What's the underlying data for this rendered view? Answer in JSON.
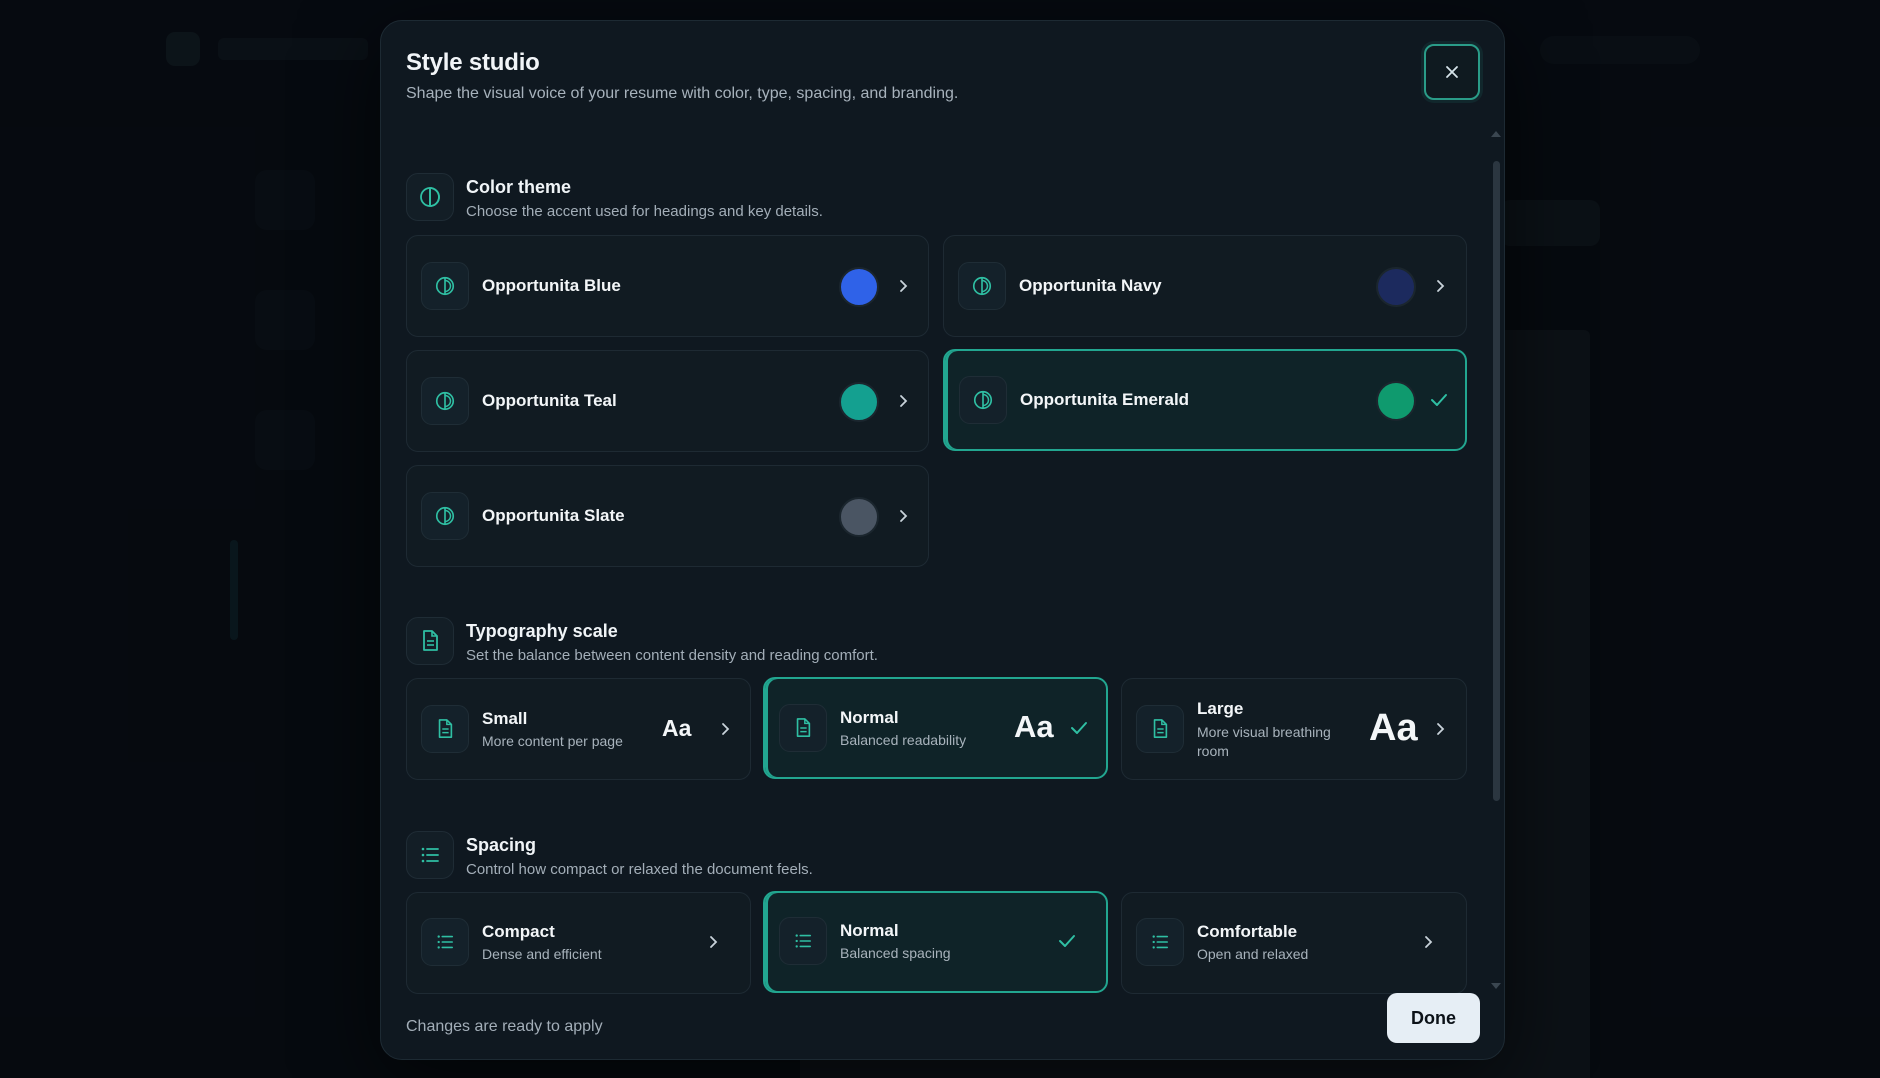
{
  "modal": {
    "title": "Style studio",
    "subtitle": "Shape the visual voice of your resume with color, type, spacing, and branding."
  },
  "color_theme": {
    "title": "Color theme",
    "subtitle": "Choose the accent used for headings and key details.",
    "options": [
      {
        "label": "Opportunita Blue",
        "color": "#2f62e8",
        "selected": false
      },
      {
        "label": "Opportunita Navy",
        "color": "#1c2a5e",
        "selected": false
      },
      {
        "label": "Opportunita Teal",
        "color": "#14a090",
        "selected": false
      },
      {
        "label": "Opportunita Emerald",
        "color": "#0f9a6e",
        "selected": true
      },
      {
        "label": "Opportunita Slate",
        "color": "#4a5563",
        "selected": false
      }
    ]
  },
  "typography": {
    "title": "Typography scale",
    "subtitle": "Set the balance between content density and reading comfort.",
    "sample": "Aa",
    "options": [
      {
        "label": "Small",
        "desc": "More content per page",
        "selected": false
      },
      {
        "label": "Normal",
        "desc": "Balanced readability",
        "selected": true
      },
      {
        "label": "Large",
        "desc": "More visual breathing room",
        "selected": false
      }
    ]
  },
  "spacing": {
    "title": "Spacing",
    "subtitle": "Control how compact or relaxed the document feels.",
    "options": [
      {
        "label": "Compact",
        "desc": "Dense and efficient",
        "selected": false
      },
      {
        "label": "Normal",
        "desc": "Balanced spacing",
        "selected": true
      },
      {
        "label": "Comfortable",
        "desc": "Open and relaxed",
        "selected": false
      }
    ]
  },
  "footer": {
    "status": "Changes are ready to apply",
    "done_label": "Done"
  },
  "colors": {
    "accent": "#22a690",
    "icon": "#2fbfa3"
  }
}
